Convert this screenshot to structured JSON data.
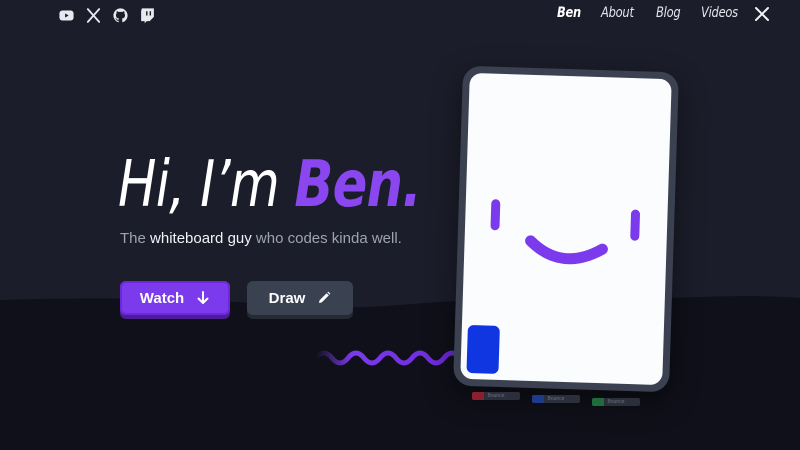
{
  "social": [
    {
      "name": "youtube-icon"
    },
    {
      "name": "x-icon"
    },
    {
      "name": "github-icon"
    },
    {
      "name": "twitch-icon"
    }
  ],
  "nav": {
    "brand": "Ben",
    "items": [
      "About",
      "Blog",
      "Videos"
    ]
  },
  "hero": {
    "greeting": "Hi, I’m ",
    "name": "Ben",
    "dot": ".",
    "subtitle_pre": "The ",
    "subtitle_highlight": "whiteboard guy",
    "subtitle_post": " who codes kinda well."
  },
  "buttons": {
    "watch_label": "Watch",
    "draw_label": "Draw"
  },
  "markers": [
    {
      "label": "Bounce",
      "color": "#8b1f2e"
    },
    {
      "label": "Bounce",
      "color": "#1f3a8b"
    },
    {
      "label": "Bounce",
      "color": "#1f6b3a"
    }
  ],
  "colors": {
    "accent": "#7c3aed",
    "background": "#1b1d2a",
    "whiteboard_blue": "#0f36e0"
  }
}
